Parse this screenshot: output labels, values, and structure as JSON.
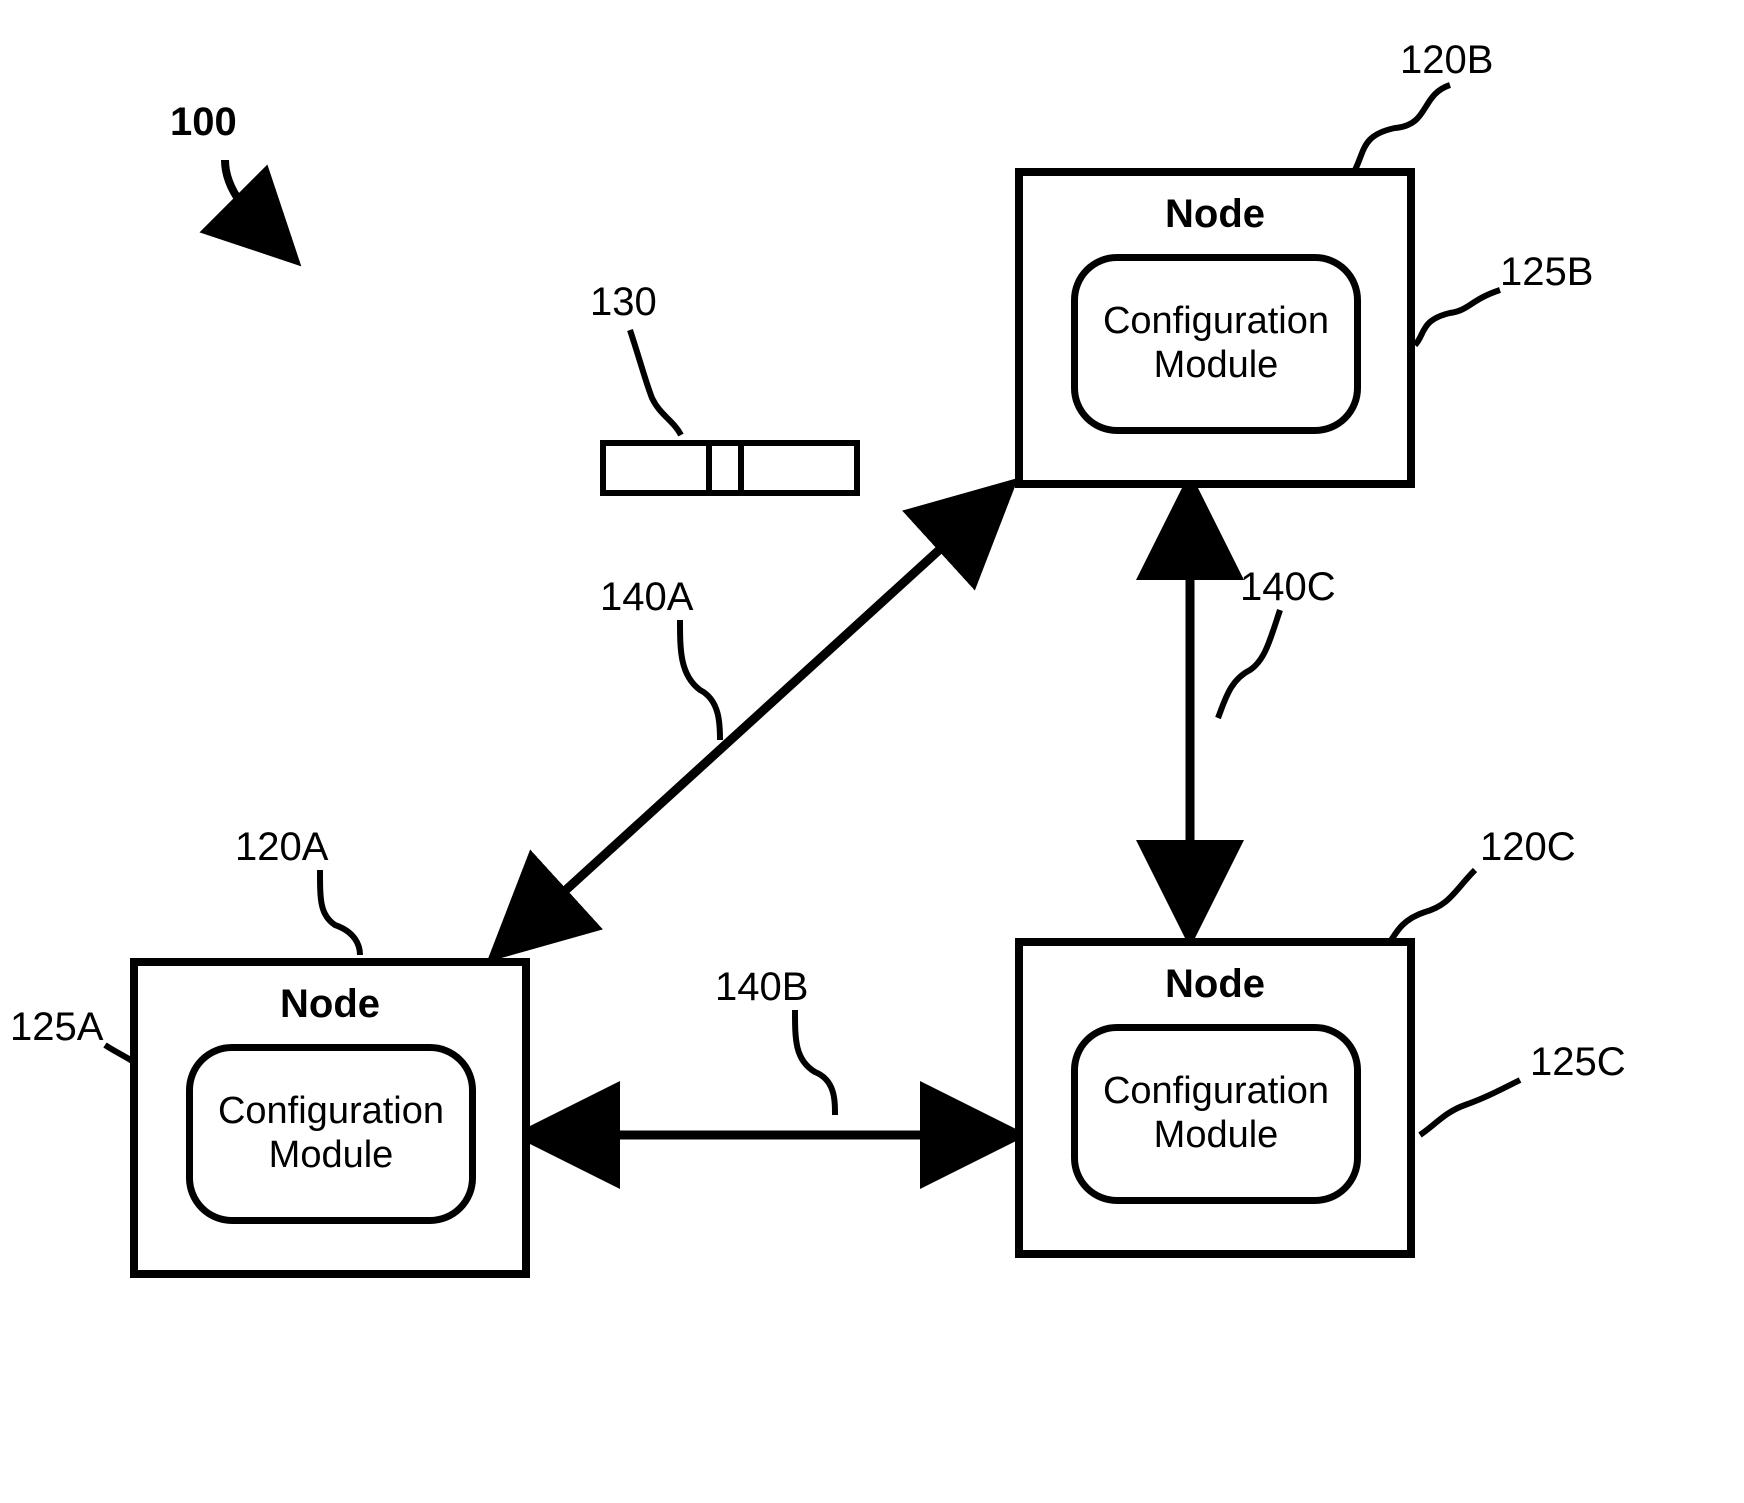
{
  "figure_ref": "100",
  "packet_ref": "130",
  "nodes": {
    "a": {
      "ref": "120A",
      "module_ref": "125A",
      "label": "Node",
      "module_label": "Configuration\nModule"
    },
    "b": {
      "ref": "120B",
      "module_ref": "125B",
      "label": "Node",
      "module_label": "Configuration\nModule"
    },
    "c": {
      "ref": "120C",
      "module_ref": "125C",
      "label": "Node",
      "module_label": "Configuration\nModule"
    }
  },
  "links": {
    "a": {
      "ref": "140A"
    },
    "b": {
      "ref": "140B"
    },
    "c": {
      "ref": "140C"
    }
  }
}
